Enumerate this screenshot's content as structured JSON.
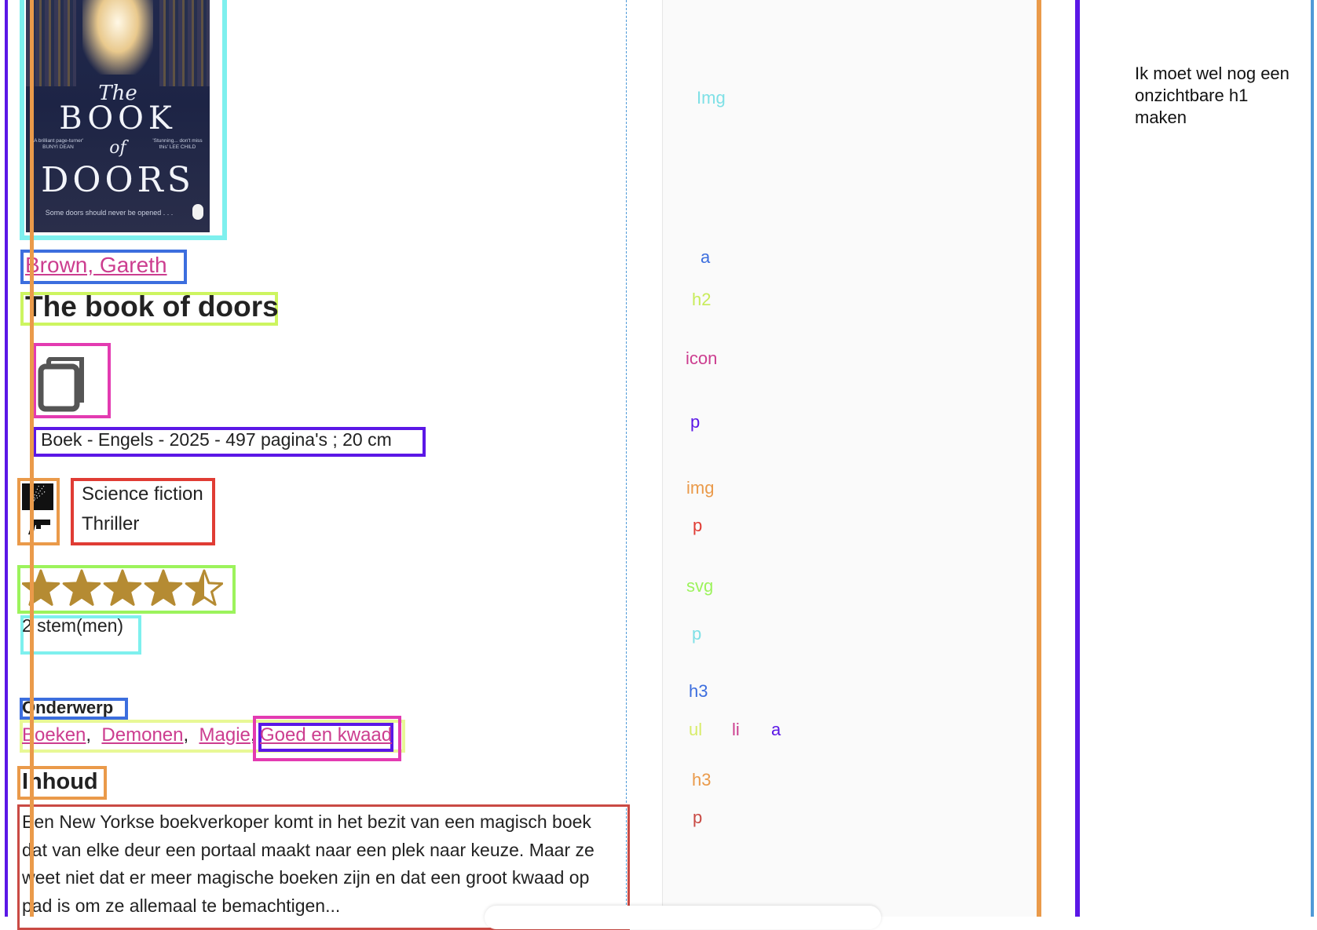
{
  "cover": {
    "title_word1": "The",
    "title_word2": "BOOK",
    "title_word3": "of",
    "title_word4": "DOORS",
    "blurb_left": "'A brilliant page-turner' BUNYI DEAN",
    "blurb_right": "'Stunning... don't miss this' LEE CHILD",
    "tagline": "Some doors should never be opened . . ."
  },
  "book": {
    "author": "Brown, Gareth",
    "title": "The book of doors",
    "format": "Boek - Engels - 2025 - 497 pagina's ; 20 cm",
    "genres": [
      "Science fiction",
      "Thriller"
    ],
    "rating": 4.5,
    "rating_max": 5,
    "votes": "2 stem(men)"
  },
  "subject": {
    "heading": "Onderwerp",
    "items": [
      "Boeken",
      "Demonen",
      "Magie",
      "Goed en kwaad"
    ]
  },
  "content": {
    "heading": "Inhoud",
    "text": "Een New Yorkse boekverkoper komt in het bezit van een magisch boek dat van elke deur een portaal maakt naar een plek naar keuze. Maar ze weet niet dat er meer magische boeken zijn en dat een groot kwaad op pad is om ze allemaal te bemachtigen..."
  },
  "annotations": {
    "img1": "Img",
    "a1": "a",
    "h2": "h2",
    "icon": "icon",
    "p1": "p",
    "img2": "img",
    "p2": "p",
    "svg": "svg",
    "p3": "p",
    "h3a": "h3",
    "ul": "ul",
    "li": "li",
    "a2": "a",
    "h3b": "h3",
    "p4": "p"
  },
  "side_note": "Ik moet wel nog een onzichtbare h1 maken",
  "colors": {
    "link": "#cc3d8f",
    "star": "#b58b33",
    "purple": "#5b17e6",
    "orange": "#ea9a4a",
    "cyan": "#7ef0ee",
    "blue": "#3c6ede",
    "lime": "#cdf560",
    "green": "#9cf35c",
    "red": "#e03c34",
    "magenta": "#e33bb1"
  }
}
